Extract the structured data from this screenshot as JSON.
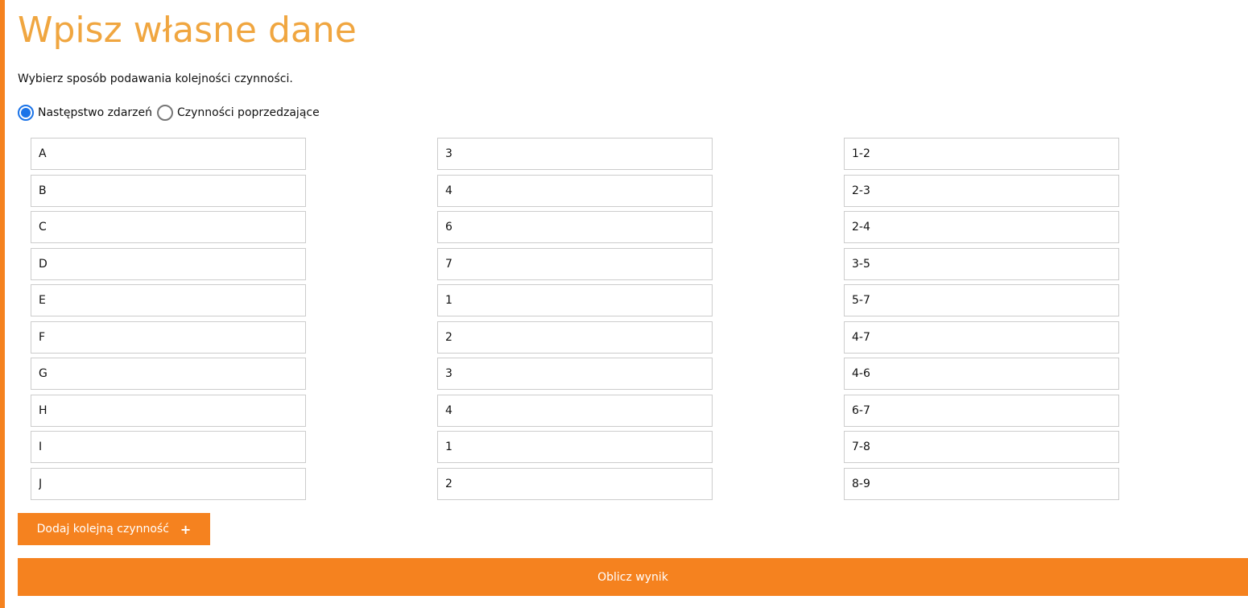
{
  "page": {
    "title": "Wpisz własne dane",
    "intro": "Wybierz sposób podawania kolejności czynności."
  },
  "mode": {
    "options": [
      {
        "label": "Następstwo zdarzeń",
        "checked": true
      },
      {
        "label": "Czynności poprzedzające",
        "checked": false
      }
    ]
  },
  "rows": [
    {
      "activity": "A",
      "duration": "3",
      "sequence": "1-2"
    },
    {
      "activity": "B",
      "duration": "4",
      "sequence": "2-3"
    },
    {
      "activity": "C",
      "duration": "6",
      "sequence": "2-4"
    },
    {
      "activity": "D",
      "duration": "7",
      "sequence": "3-5"
    },
    {
      "activity": "E",
      "duration": "1",
      "sequence": "5-7"
    },
    {
      "activity": "F",
      "duration": "2",
      "sequence": "4-7"
    },
    {
      "activity": "G",
      "duration": "3",
      "sequence": "4-6"
    },
    {
      "activity": "H",
      "duration": "4",
      "sequence": "6-7"
    },
    {
      "activity": "I",
      "duration": "1",
      "sequence": "7-8"
    },
    {
      "activity": "J",
      "duration": "2",
      "sequence": "8-9"
    }
  ],
  "buttons": {
    "add_label": "Dodaj kolejną czynność",
    "add_icon": "+",
    "calculate_label": "Oblicz wynik"
  },
  "colors": {
    "accent": "#f5821f",
    "title": "#f0a640",
    "radio_checked": "#1a73e8"
  }
}
